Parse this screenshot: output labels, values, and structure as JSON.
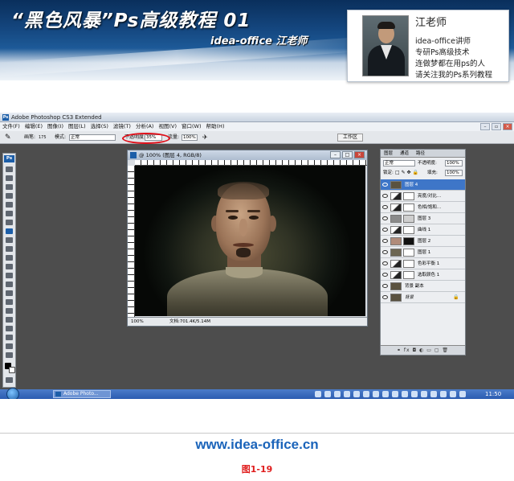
{
  "banner": {
    "title": "“黑色风暴”Ps高级教程 01",
    "subtitle": "idea-office 江老师"
  },
  "teacher": {
    "name": "江老师",
    "lines": [
      "idea-office讲师",
      "专研Ps高级技术",
      "连做梦都在用ps的人",
      "请关注我的Ps系列教程"
    ]
  },
  "ps": {
    "window_title": "Adobe Photoshop CS3 Extended",
    "menu": [
      "文件(F)",
      "编辑(E)",
      "图像(I)",
      "图层(L)",
      "选择(S)",
      "滤镜(T)",
      "分析(A)",
      "视图(V)",
      "窗口(W)",
      "帮助(H)"
    ],
    "options": {
      "brush_label": "画笔:",
      "brush_size": "175",
      "mode_label": "模式:",
      "mode_value": "正常",
      "opacity_label": "不透明度:",
      "opacity_value": "35%",
      "flow_label": "流量:",
      "flow_value": "100%",
      "workspace_label": "工作区"
    },
    "document": {
      "title": "@ 100% (图层 4, RGB/8)",
      "zoom": "100%",
      "doc_size": "文档:701.4K/5.14M"
    },
    "layers_panel": {
      "tabs": [
        "图层",
        "通道",
        "路径"
      ],
      "blend_mode": "正常",
      "opacity_label": "不透明度:",
      "opacity_value": "100%",
      "lock_label": "锁定:",
      "fill_label": "填充:",
      "fill_value": "100%",
      "layers": [
        {
          "name": "图层 4",
          "selected": true,
          "kind": "pixel"
        },
        {
          "name": "亮度/对比...",
          "selected": false,
          "kind": "adjustment"
        },
        {
          "name": "色相/饱和...",
          "selected": false,
          "kind": "adjustment"
        },
        {
          "name": "图层 3",
          "selected": false,
          "kind": "pixel"
        },
        {
          "name": "曲线 1",
          "selected": false,
          "kind": "adjustment"
        },
        {
          "name": "图层 2",
          "selected": false,
          "kind": "pixel"
        },
        {
          "name": "图层 1",
          "selected": false,
          "kind": "pixel"
        },
        {
          "name": "色彩平衡 1",
          "selected": false,
          "kind": "adjustment"
        },
        {
          "name": "选取颜色 1",
          "selected": false,
          "kind": "adjustment"
        },
        {
          "name": "背景 副本",
          "selected": false,
          "kind": "pixel"
        },
        {
          "name": "背景",
          "selected": false,
          "kind": "pixel"
        }
      ]
    },
    "taskbar": {
      "ps_task": "Adobe Photo...",
      "clock": "11:50"
    }
  },
  "footer": {
    "url": "www.idea-office.cn",
    "caption": "图1-19"
  },
  "colors": {
    "banner_blue": "#14467e",
    "highlight_red": "#e0101a",
    "footer_blue": "#1b64ba",
    "caption_red": "#e01d1d",
    "layer_selected": "#3e76c8"
  }
}
